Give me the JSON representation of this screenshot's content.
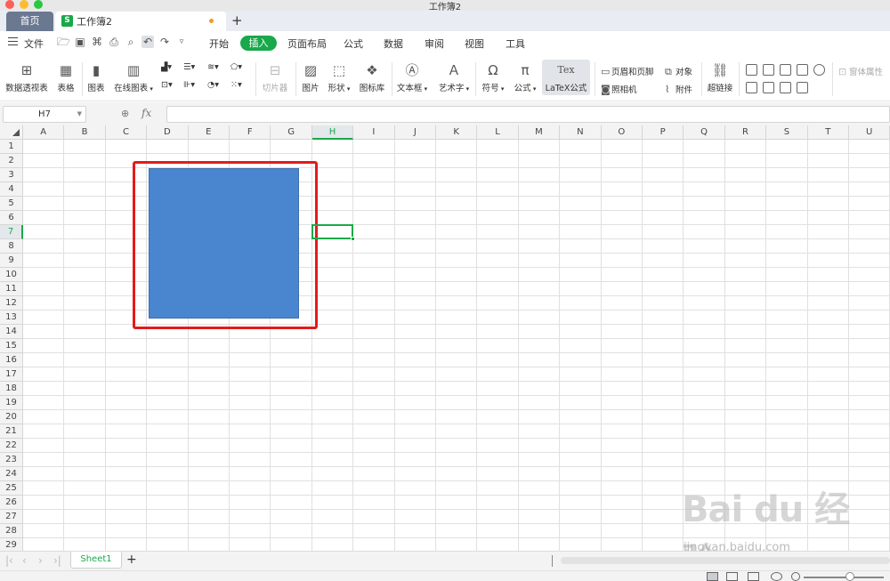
{
  "window": {
    "title": "工作簿2"
  },
  "tabs": {
    "home": "首页",
    "doc": "工作簿2",
    "doc_icon": "S",
    "add": "+"
  },
  "menu": {
    "file": "文件",
    "items": [
      "开始",
      "插入",
      "页面布局",
      "公式",
      "数据",
      "审阅",
      "视图",
      "工具"
    ],
    "active": "插入"
  },
  "ribbon": {
    "pivot": "数据透视表",
    "table": "表格",
    "chart": "图表",
    "online_chart": "在线图表",
    "screenshot": "切片器",
    "picture": "图片",
    "shape": "形状",
    "icon_lib": "图标库",
    "textbox": "文本框",
    "wordart": "艺术字",
    "symbol": "符号",
    "formula": "公式",
    "latex_icon": "Tex",
    "latex": "LaTeX公式",
    "header_footer": "页眉和页脚",
    "camera": "照相机",
    "object": "对象",
    "attachment": "附件",
    "hyperlink": "超链接",
    "form_props": "窗体属性"
  },
  "formula_bar": {
    "cell_ref": "H7",
    "fx": "fx",
    "value": ""
  },
  "grid": {
    "columns": [
      "A",
      "B",
      "C",
      "D",
      "E",
      "F",
      "G",
      "H",
      "I",
      "J",
      "K",
      "L",
      "M",
      "N",
      "O",
      "P",
      "Q",
      "R",
      "S",
      "T",
      "U"
    ],
    "rows": [
      "1",
      "2",
      "3",
      "4",
      "5",
      "6",
      "7",
      "8",
      "9",
      "10",
      "11",
      "12",
      "13",
      "14",
      "15",
      "16",
      "17",
      "18",
      "19",
      "20",
      "21",
      "22",
      "23",
      "24",
      "25",
      "26",
      "27",
      "28",
      "29"
    ],
    "active_column": "H",
    "active_row": "7"
  },
  "sheets": {
    "names": [
      "Sheet1"
    ],
    "add": "+"
  },
  "watermark": {
    "main": "Bai du 经验",
    "sub": "jingyan.baidu.com"
  },
  "colors": {
    "accent": "#19a84a",
    "shape_fill": "#4a86cf",
    "highlight": "#e31b1b"
  }
}
